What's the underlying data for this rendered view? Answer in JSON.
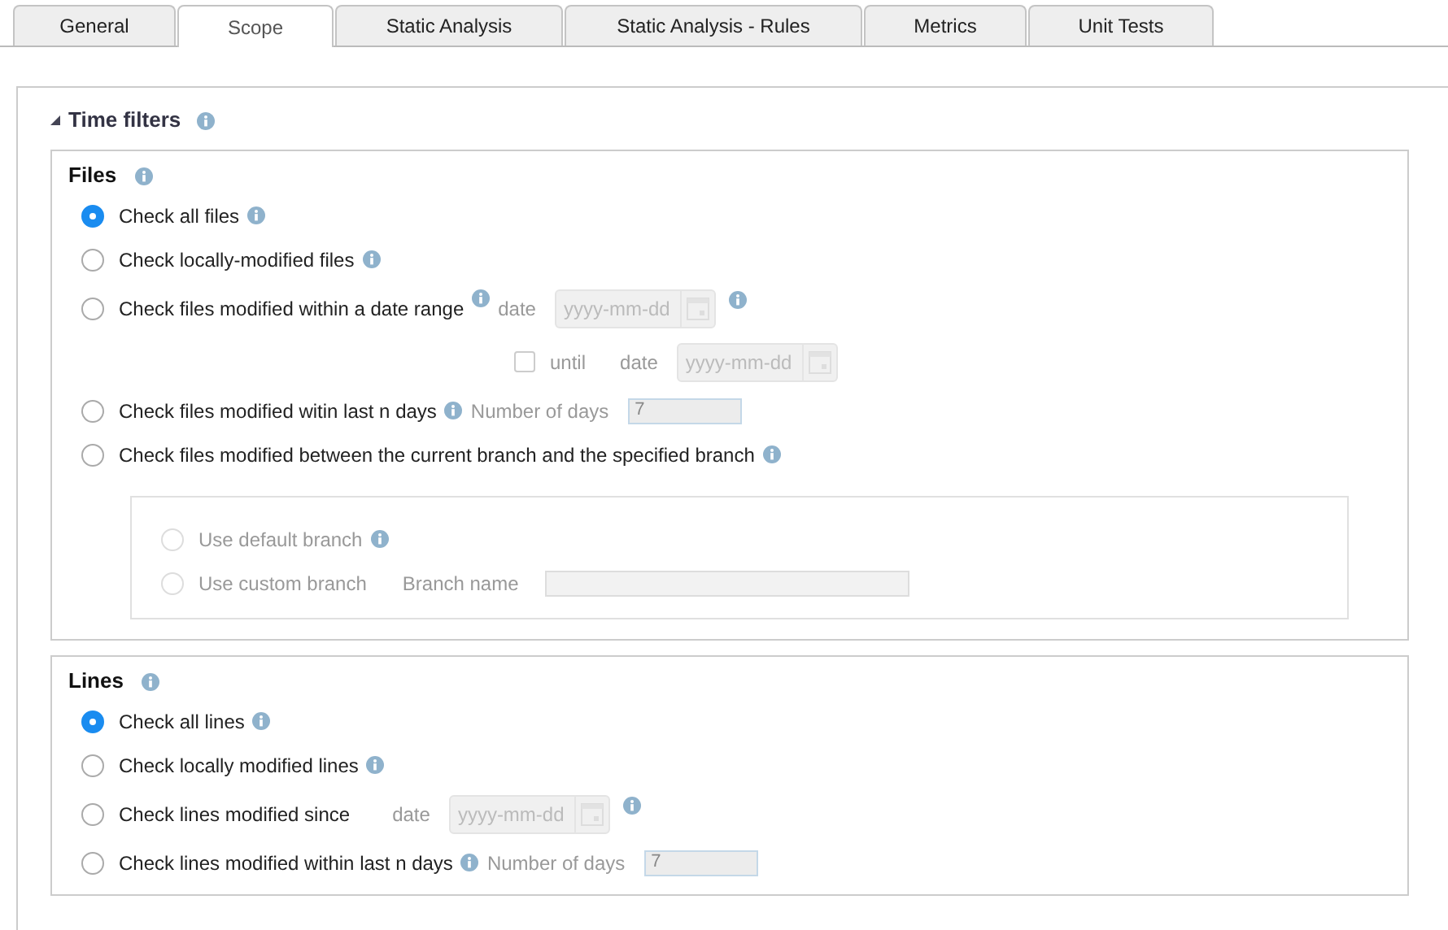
{
  "tabs": [
    {
      "label": "General",
      "selected": false
    },
    {
      "label": "Scope",
      "selected": true
    },
    {
      "label": "Static Analysis",
      "selected": false
    },
    {
      "label": "Static Analysis - Rules",
      "selected": false
    },
    {
      "label": "Metrics",
      "selected": false
    },
    {
      "label": "Unit Tests",
      "selected": false
    }
  ],
  "section": {
    "title": "Time filters",
    "expanded": true
  },
  "groups": [
    {
      "title": "Files",
      "options": [
        {
          "kind": "plain",
          "label": "Check all files",
          "selected": true,
          "info": true
        },
        {
          "kind": "plain",
          "label": "Check locally-modified files",
          "selected": false,
          "info": true
        },
        {
          "kind": "date",
          "label": "Check files modified within a date range",
          "selected": false,
          "info": true,
          "date_label": "date",
          "placeholder": "yyyy-mm-dd",
          "field_info": true,
          "until": {
            "label": "until",
            "checked": false,
            "date_label": "date",
            "placeholder": "yyyy-mm-dd"
          }
        },
        {
          "kind": "days",
          "label": "Check files modified witin last n days",
          "selected": false,
          "info": true,
          "days_label": "Number of days",
          "days": "7"
        },
        {
          "kind": "branch",
          "label": "Check files modified between the current branch and the specified branch",
          "selected": false,
          "info": true,
          "branches": [
            {
              "label": "Use default branch",
              "selected": false,
              "disabled": true,
              "info": true
            },
            {
              "label": "Use custom branch",
              "selected": false,
              "disabled": true,
              "info": false,
              "name_label": "Branch name"
            }
          ]
        }
      ]
    },
    {
      "title": "Lines",
      "options": [
        {
          "kind": "plain",
          "label": "Check all lines",
          "selected": true,
          "info": true
        },
        {
          "kind": "plain",
          "label": "Check locally modified lines",
          "selected": false,
          "info": true
        },
        {
          "kind": "date",
          "label": "Check lines modified since",
          "selected": false,
          "info": false,
          "date_label": "date",
          "placeholder": "yyyy-mm-dd",
          "field_info": true
        },
        {
          "kind": "days",
          "label": "Check lines modified within last n days",
          "selected": false,
          "info": true,
          "days_label": "Number of days",
          "days": "7"
        }
      ]
    }
  ]
}
